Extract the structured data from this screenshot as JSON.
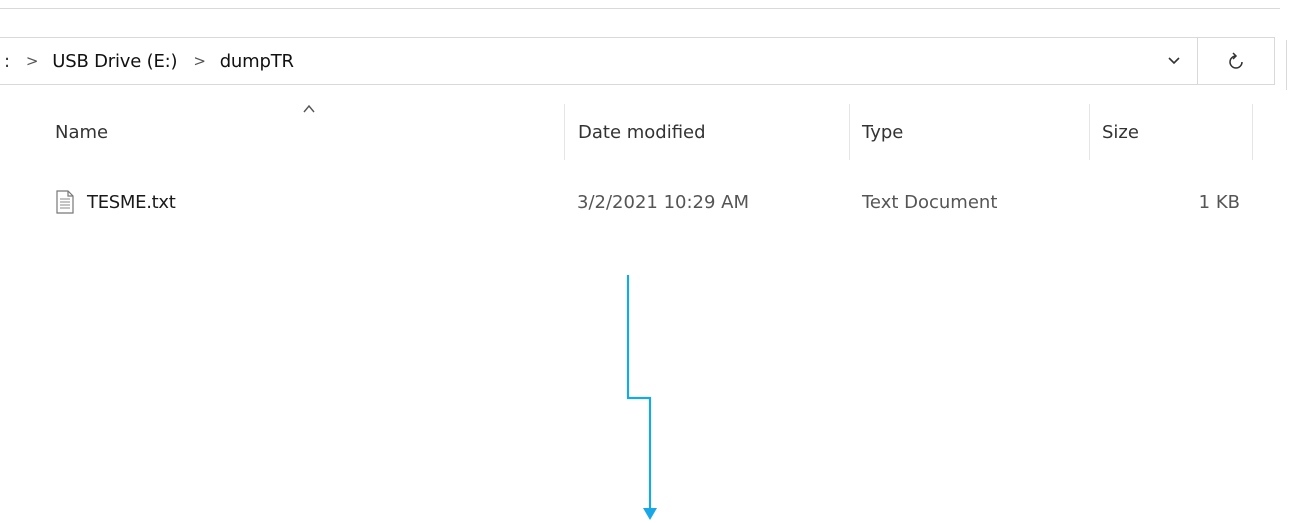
{
  "address_bar": {
    "crumb_fragment": ":",
    "crumbs": [
      "USB Drive (E:)",
      "dumpTR"
    ],
    "separator": ">",
    "dropdown_icon": "chevron-down-icon",
    "refresh_icon": "refresh-icon"
  },
  "columns": {
    "name": "Name",
    "date_modified": "Date modified",
    "type": "Type",
    "size": "Size",
    "sort_indicator": "^"
  },
  "files": [
    {
      "name": "TESME.txt",
      "date_modified": "3/2/2021 10:29 AM",
      "type": "Text Document",
      "size": "1 KB",
      "icon": "text-file-icon"
    }
  ],
  "annotation": {
    "arrow_color": "#1aa7e8"
  }
}
